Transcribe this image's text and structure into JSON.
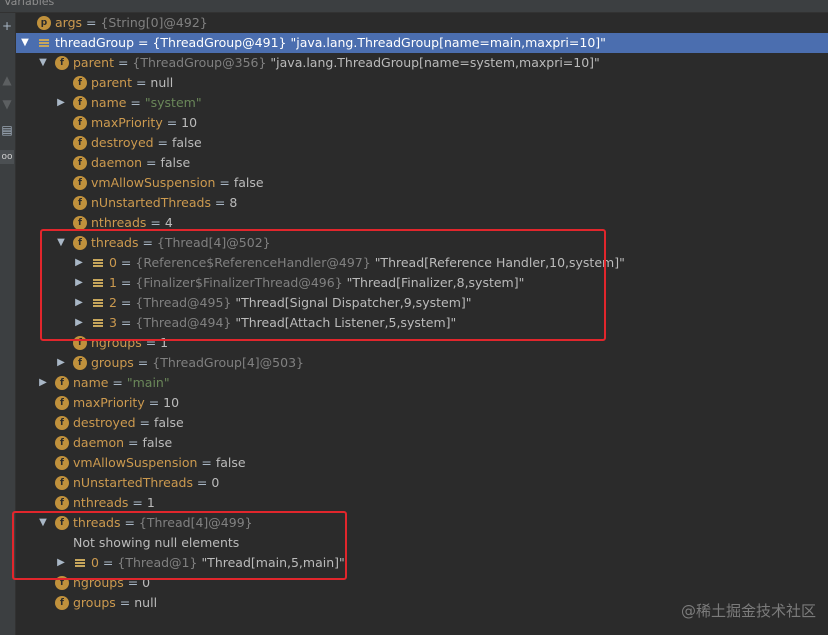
{
  "panel": {
    "title": "Variables"
  },
  "gutter": {
    "icons": [
      "plus-icon",
      "up-icon",
      "down-icon",
      "copy-icon",
      "glasses-icon"
    ]
  },
  "rows": [
    {
      "indent": 0,
      "arrow": "",
      "icon": "p",
      "name": "args",
      "ref": "{String[0]@492}",
      "value": "",
      "selected": false
    },
    {
      "indent": 0,
      "arrow": "down",
      "icon": "bars",
      "name": "threadGroup",
      "ref": "{ThreadGroup@491}",
      "value": "\"java.lang.ThreadGroup[name=main,maxpri=10]\"",
      "selected": true
    },
    {
      "indent": 1,
      "arrow": "down",
      "icon": "f",
      "name": "parent",
      "ref": "{ThreadGroup@356}",
      "value": "\"java.lang.ThreadGroup[name=system,maxpri=10]\"",
      "selected": false
    },
    {
      "indent": 2,
      "arrow": "",
      "icon": "f",
      "name": "parent",
      "ref": "",
      "value": "null",
      "selected": false
    },
    {
      "indent": 2,
      "arrow": "right",
      "icon": "f",
      "name": "name",
      "ref": "",
      "value": "\"system\"",
      "string": true,
      "selected": false
    },
    {
      "indent": 2,
      "arrow": "",
      "icon": "f",
      "name": "maxPriority",
      "ref": "",
      "value": "10",
      "selected": false
    },
    {
      "indent": 2,
      "arrow": "",
      "icon": "f",
      "name": "destroyed",
      "ref": "",
      "value": "false",
      "selected": false
    },
    {
      "indent": 2,
      "arrow": "",
      "icon": "f",
      "name": "daemon",
      "ref": "",
      "value": "false",
      "selected": false
    },
    {
      "indent": 2,
      "arrow": "",
      "icon": "f",
      "name": "vmAllowSuspension",
      "ref": "",
      "value": "false",
      "selected": false
    },
    {
      "indent": 2,
      "arrow": "",
      "icon": "f",
      "name": "nUnstartedThreads",
      "ref": "",
      "value": "8",
      "selected": false
    },
    {
      "indent": 2,
      "arrow": "",
      "icon": "f",
      "name": "nthreads",
      "ref": "",
      "value": "4",
      "selected": false
    },
    {
      "indent": 2,
      "arrow": "down",
      "icon": "f",
      "name": "threads",
      "ref": "{Thread[4]@502}",
      "value": "",
      "selected": false
    },
    {
      "indent": 3,
      "arrow": "right",
      "icon": "bars",
      "name": "0",
      "ref": "{Reference$ReferenceHandler@497}",
      "value": "\"Thread[Reference Handler,10,system]\"",
      "selected": false
    },
    {
      "indent": 3,
      "arrow": "right",
      "icon": "bars",
      "name": "1",
      "ref": "{Finalizer$FinalizerThread@496}",
      "value": "\"Thread[Finalizer,8,system]\"",
      "selected": false
    },
    {
      "indent": 3,
      "arrow": "right",
      "icon": "bars",
      "name": "2",
      "ref": "{Thread@495}",
      "value": "\"Thread[Signal Dispatcher,9,system]\"",
      "selected": false
    },
    {
      "indent": 3,
      "arrow": "right",
      "icon": "bars",
      "name": "3",
      "ref": "{Thread@494}",
      "value": "\"Thread[Attach Listener,5,system]\"",
      "selected": false
    },
    {
      "indent": 2,
      "arrow": "",
      "icon": "f",
      "name": "ngroups",
      "ref": "",
      "value": "1",
      "selected": false
    },
    {
      "indent": 2,
      "arrow": "right",
      "icon": "f",
      "name": "groups",
      "ref": "{ThreadGroup[4]@503}",
      "value": "",
      "selected": false
    },
    {
      "indent": 1,
      "arrow": "right",
      "icon": "f",
      "name": "name",
      "ref": "",
      "value": "\"main\"",
      "string": true,
      "selected": false
    },
    {
      "indent": 1,
      "arrow": "",
      "icon": "f",
      "name": "maxPriority",
      "ref": "",
      "value": "10",
      "selected": false
    },
    {
      "indent": 1,
      "arrow": "",
      "icon": "f",
      "name": "destroyed",
      "ref": "",
      "value": "false",
      "selected": false
    },
    {
      "indent": 1,
      "arrow": "",
      "icon": "f",
      "name": "daemon",
      "ref": "",
      "value": "false",
      "selected": false
    },
    {
      "indent": 1,
      "arrow": "",
      "icon": "f",
      "name": "vmAllowSuspension",
      "ref": "",
      "value": "false",
      "selected": false
    },
    {
      "indent": 1,
      "arrow": "",
      "icon": "f",
      "name": "nUnstartedThreads",
      "ref": "",
      "value": "0",
      "selected": false
    },
    {
      "indent": 1,
      "arrow": "",
      "icon": "f",
      "name": "nthreads",
      "ref": "",
      "value": "1",
      "selected": false
    },
    {
      "indent": 1,
      "arrow": "down",
      "icon": "f",
      "name": "threads",
      "ref": "{Thread[4]@499}",
      "value": "",
      "selected": false
    },
    {
      "indent": 2,
      "arrow": "",
      "icon": "none",
      "name": "",
      "ref": "",
      "value": "",
      "message": "Not showing null elements",
      "selected": false
    },
    {
      "indent": 2,
      "arrow": "right",
      "icon": "bars",
      "name": "0",
      "ref": "{Thread@1}",
      "value": "\"Thread[main,5,main]\"",
      "selected": false
    },
    {
      "indent": 1,
      "arrow": "",
      "icon": "f",
      "name": "ngroups",
      "ref": "",
      "value": "0",
      "selected": false
    },
    {
      "indent": 1,
      "arrow": "",
      "icon": "f",
      "name": "groups",
      "ref": "",
      "value": "null",
      "selected": false
    }
  ],
  "highlights": [
    "system-threads-box",
    "main-threads-box"
  ],
  "colors": {
    "background": "#2b2b2b",
    "selection": "#4b6eaf",
    "field_badge": "#c0913c",
    "highlight_border": "#e1262c",
    "string_value": "#6a8759"
  },
  "watermark": "@稀土掘金技术社区"
}
